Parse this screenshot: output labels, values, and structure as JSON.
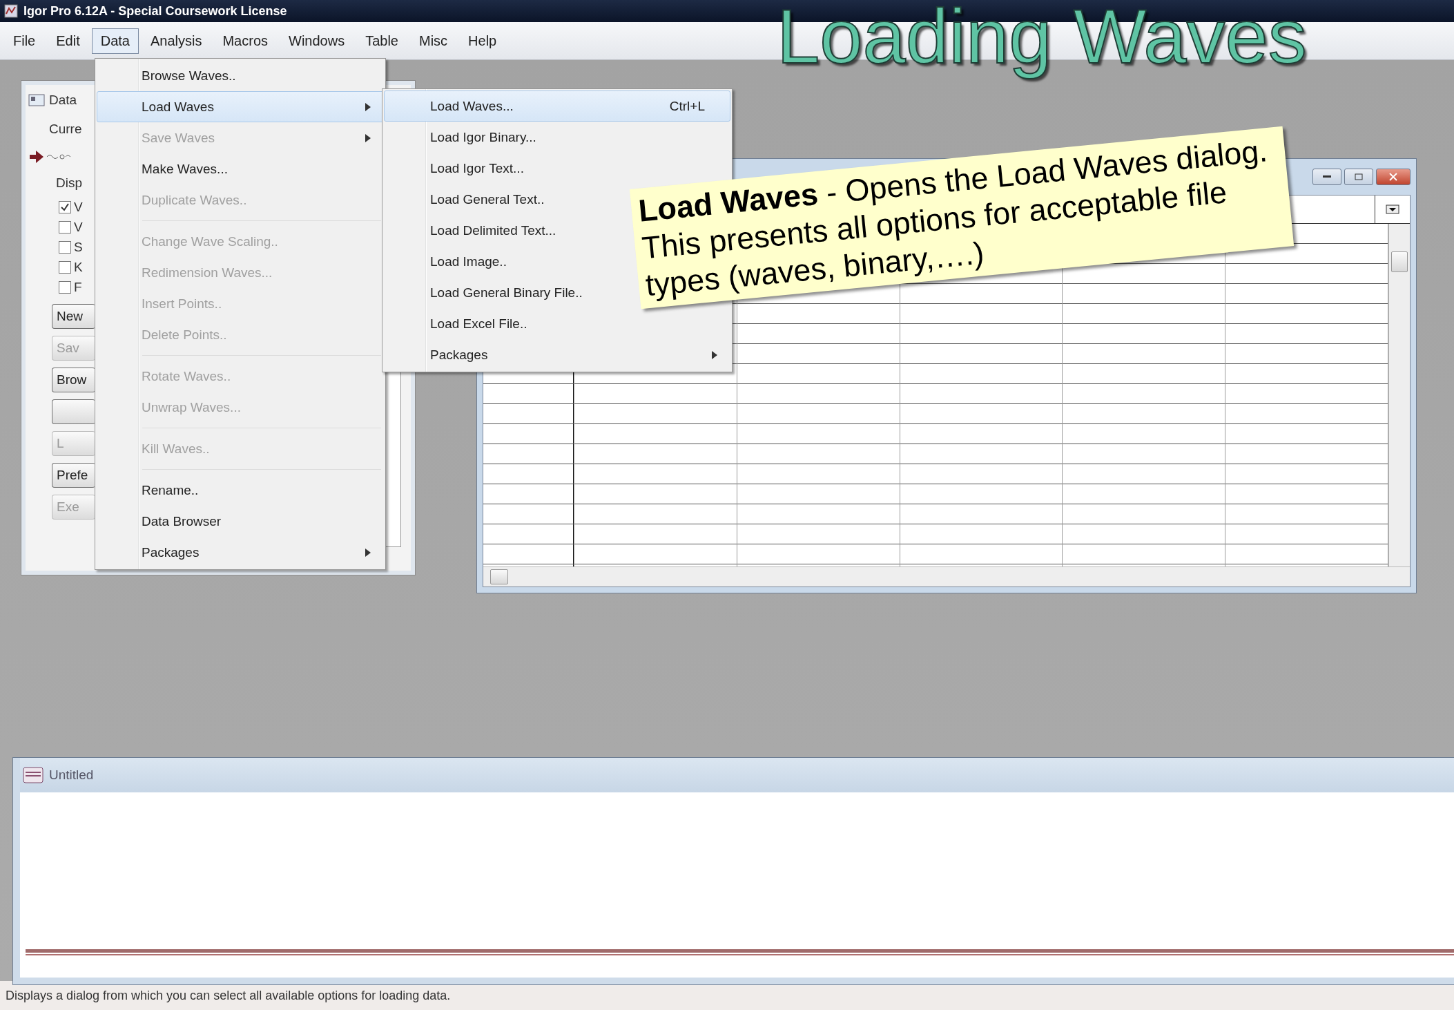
{
  "slide_title": "Loading Waves",
  "window": {
    "title": "Igor Pro 6.12A - Special Coursework License"
  },
  "menu_bar": [
    {
      "label": "File",
      "selected": false
    },
    {
      "label": "Edit",
      "selected": false
    },
    {
      "label": "Data",
      "selected": true
    },
    {
      "label": "Analysis",
      "selected": false
    },
    {
      "label": "Macros",
      "selected": false
    },
    {
      "label": "Windows",
      "selected": false
    },
    {
      "label": "Table",
      "selected": false
    },
    {
      "label": "Misc",
      "selected": false
    },
    {
      "label": "Help",
      "selected": false
    }
  ],
  "data_browser": {
    "title": "Data",
    "current_label": "Curre",
    "display_label": "Disp",
    "checkboxes": [
      {
        "label": "V",
        "checked": true
      },
      {
        "label": "V",
        "checked": false
      },
      {
        "label": "S",
        "checked": false
      },
      {
        "label": "K",
        "checked": false
      },
      {
        "label": "F",
        "checked": false
      }
    ],
    "buttons": [
      {
        "label": "New",
        "disabled": false
      },
      {
        "label": "Sav",
        "disabled": true
      },
      {
        "label": "Brow",
        "disabled": false
      },
      {
        "disabled": false
      },
      {
        "label": "L",
        "disabled": true
      },
      {
        "label": "Prefe",
        "disabled": false
      },
      {
        "label": "Exe",
        "disabled": true
      }
    ]
  },
  "data_menu": {
    "items": [
      {
        "label": "Browse Waves..",
        "selected": false,
        "disabled": false,
        "submenu": false,
        "separator_after": false
      },
      {
        "label": "Load Waves",
        "selected": true,
        "disabled": false,
        "submenu": true,
        "separator_after": false
      },
      {
        "label": "Save Waves",
        "selected": false,
        "disabled": true,
        "submenu": true,
        "separator_after": false
      },
      {
        "label": "Make Waves...",
        "selected": false,
        "disabled": false,
        "submenu": false,
        "separator_after": false
      },
      {
        "label": "Duplicate Waves..",
        "selected": false,
        "disabled": true,
        "submenu": false,
        "separator_after": true
      },
      {
        "label": "Change Wave Scaling..",
        "selected": false,
        "disabled": true,
        "submenu": false,
        "separator_after": false
      },
      {
        "label": "Redimension Waves...",
        "selected": false,
        "disabled": true,
        "submenu": false,
        "separator_after": false
      },
      {
        "label": "Insert Points..",
        "selected": false,
        "disabled": true,
        "submenu": false,
        "separator_after": false
      },
      {
        "label": "Delete Points..",
        "selected": false,
        "disabled": true,
        "submenu": false,
        "separator_after": true
      },
      {
        "label": "Rotate Waves..",
        "selected": false,
        "disabled": true,
        "submenu": false,
        "separator_after": false
      },
      {
        "label": "Unwrap Waves...",
        "selected": false,
        "disabled": true,
        "submenu": false,
        "separator_after": true
      },
      {
        "label": "Kill Waves..",
        "selected": false,
        "disabled": true,
        "submenu": false,
        "separator_after": true
      },
      {
        "label": "Rename..",
        "selected": false,
        "disabled": false,
        "submenu": false,
        "separator_after": false
      },
      {
        "label": "Data Browser",
        "selected": false,
        "disabled": false,
        "submenu": false,
        "separator_after": false
      },
      {
        "label": "Packages",
        "selected": false,
        "disabled": false,
        "submenu": true,
        "separator_after": false
      }
    ]
  },
  "load_waves_submenu": {
    "items": [
      {
        "label": "Load Waves...",
        "shortcut": "Ctrl+L",
        "selected": true,
        "kind": "command"
      },
      {
        "label": "Load Igor Binary...",
        "selected": false,
        "kind": "command"
      },
      {
        "label": "Load Igor Text...",
        "selected": false,
        "kind": "command"
      },
      {
        "label": "Load General Text..",
        "selected": false,
        "kind": "command"
      },
      {
        "label": "Load Delimited Text...",
        "selected": false,
        "kind": "command"
      },
      {
        "label": "Load Image..",
        "selected": false,
        "kind": "command"
      },
      {
        "label": "Load General Binary File..",
        "selected": false,
        "kind": "command"
      },
      {
        "label": "Load Excel File..",
        "selected": false,
        "kind": "command"
      },
      {
        "label": "Packages",
        "selected": false,
        "kind": "submenu"
      }
    ]
  },
  "callout": {
    "text": "**Load Waves** - Opens the Load Waves dialog. This presents all options for acceptable file types (waves, binary,….)"
  },
  "command_window": {
    "title": "Untitled"
  },
  "status_bar": "Displays a dialog from which you can select all available options for loading data."
}
